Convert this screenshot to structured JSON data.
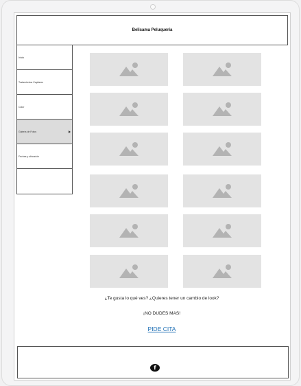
{
  "header": {
    "title": "Belisama Peluquería"
  },
  "nav": {
    "items": [
      {
        "label": "Inicio"
      },
      {
        "label": "Tratamientos Capilares"
      },
      {
        "label": "Color"
      },
      {
        "label": "Galería de Fotos",
        "active": true
      },
      {
        "label": "Fechas y ubicación"
      }
    ]
  },
  "gallery": {
    "placeholder_icon": "image-placeholder-icon",
    "rows": 6,
    "columns": 2
  },
  "main": {
    "question": "¿Te gusta lo qué ves? ¿Quieres tener un cambio de look?",
    "exclaim": "¡NO DUDES MAS!",
    "cta_label": "PIDE CITA"
  },
  "footer": {
    "social_icon": "facebook-icon",
    "social_glyph": "f"
  },
  "colors": {
    "link": "#1e6fb5",
    "tile": "#e3e3e3",
    "icon": "#b3b3b3",
    "active_nav": "#dcdcdc"
  }
}
